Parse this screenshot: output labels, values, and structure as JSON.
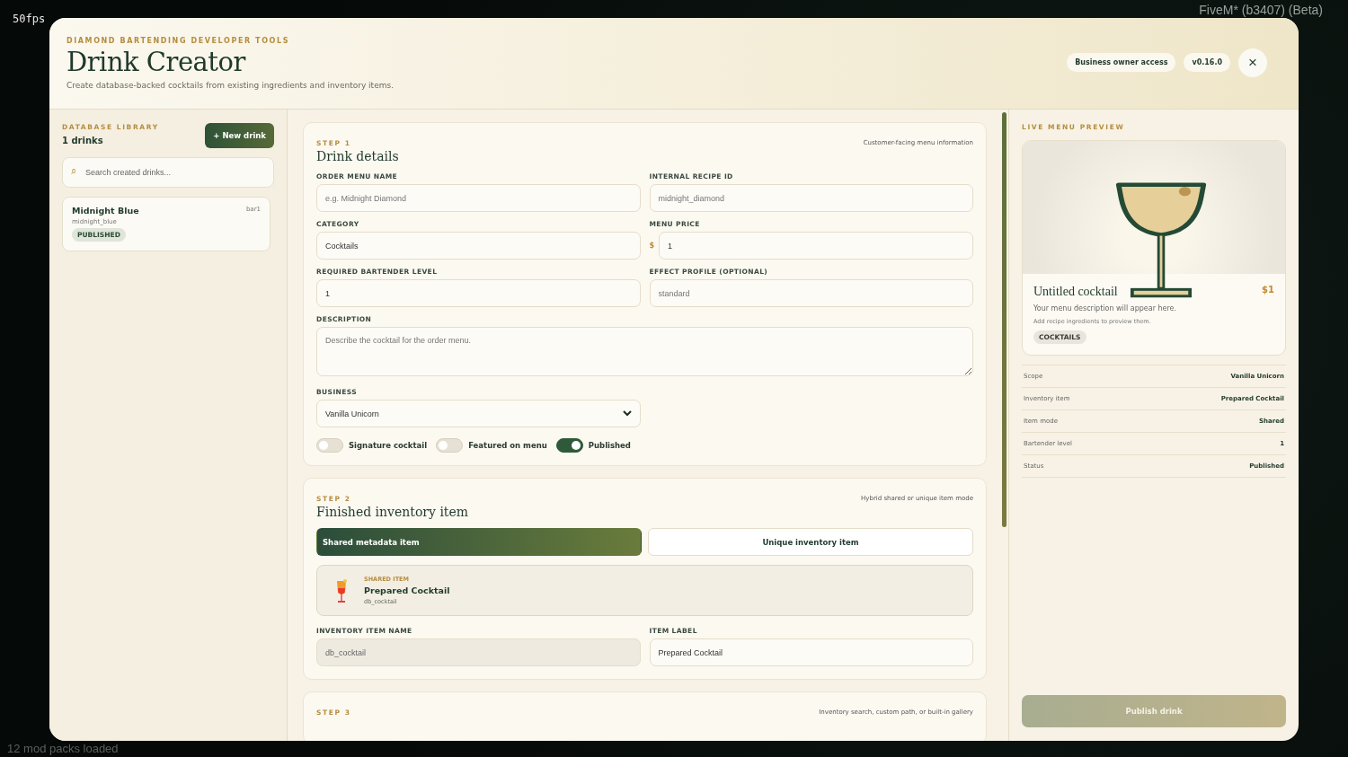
{
  "overlay": {
    "fps": "50fps",
    "client": "FiveM* (b3407) (Beta)",
    "status": "12 mod packs loaded"
  },
  "header": {
    "eyebrow": "DIAMOND BARTENDING DEVELOPER TOOLS",
    "title": "Drink Creator",
    "subtitle": "Create database-backed cocktails from existing ingredients and inventory items.",
    "badges": [
      "Business owner access",
      "v0.16.0"
    ],
    "close": "×"
  },
  "library": {
    "eyebrow": "DATABASE LIBRARY",
    "count": "1 drinks",
    "new_button": "+ New drink",
    "search": {
      "icon": "⌕",
      "placeholder": "Search created drinks..."
    },
    "drinks": [
      {
        "name": "Midnight Blue",
        "id": "midnight_blue",
        "tag": "bar1",
        "status": "PUBLISHED"
      }
    ]
  },
  "step1": {
    "step": "STEP 1",
    "title": "Drink details",
    "hint": "Customer-facing menu information",
    "fields": [
      {
        "kind": "input",
        "label": "ORDER MENU NAME",
        "placeholder": "e.g. Midnight Diamond"
      },
      {
        "kind": "input",
        "label": "INTERNAL RECIPE ID",
        "placeholder": "midnight_diamond"
      },
      {
        "kind": "input",
        "label": "CATEGORY",
        "value": "Cocktails"
      },
      {
        "kind": "price",
        "label": "MENU PRICE",
        "prefix": "$",
        "value": "1"
      },
      {
        "kind": "input",
        "label": "REQUIRED BARTENDER LEVEL",
        "value": "1"
      },
      {
        "kind": "input",
        "label": "EFFECT PROFILE (OPTIONAL)",
        "placeholder": "standard"
      },
      {
        "kind": "textarea",
        "label": "DESCRIPTION",
        "placeholder": "Describe the cocktail for the order menu."
      },
      {
        "kind": "select",
        "label": "BUSINESS",
        "value": "Vanilla Unicorn"
      }
    ],
    "toggles": [
      {
        "label": "Signature cocktail",
        "on": false
      },
      {
        "label": "Featured on menu",
        "on": false
      },
      {
        "label": "Published",
        "on": true
      }
    ]
  },
  "step2": {
    "step": "STEP 2",
    "title": "Finished inventory item",
    "hint": "Hybrid shared or unique item mode",
    "modes": [
      {
        "label": "Shared metadata item",
        "selected": true
      },
      {
        "label": "Unique inventory item",
        "selected": false
      }
    ],
    "item": {
      "eyebrow": "SHARED ITEM",
      "name": "Prepared Cocktail",
      "id": "db_cocktail"
    },
    "fields": [
      {
        "kind": "input",
        "label": "INVENTORY ITEM NAME",
        "value": "db_cocktail",
        "disabled": true
      },
      {
        "kind": "input",
        "label": "ITEM LABEL",
        "value": "Prepared Cocktail",
        "disabled": false
      }
    ]
  },
  "step3": {
    "step": "STEP 3",
    "hint": "Inventory search, custom path, or built-in gallery"
  },
  "preview": {
    "eyebrow": "LIVE MENU PREVIEW",
    "name": "Untitled cocktail",
    "price": "$1",
    "description": "Your menu description will appear here.",
    "ingredients": "Add recipe ingredients to preview them.",
    "category": "COCKTAILS",
    "details": [
      {
        "label": "Scope",
        "value": "Vanilla Unicorn"
      },
      {
        "label": "Inventory item",
        "value": "Prepared Cocktail"
      },
      {
        "label": "Item mode",
        "value": "Shared"
      },
      {
        "label": "Bartender level",
        "value": "1"
      },
      {
        "label": "Status",
        "value": "Published"
      }
    ],
    "publish": "Publish drink"
  }
}
